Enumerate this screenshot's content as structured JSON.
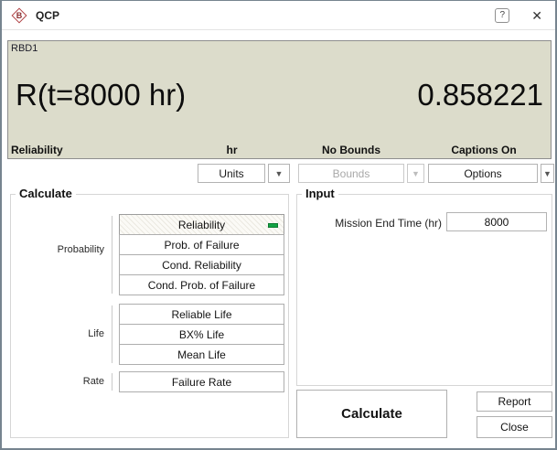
{
  "window": {
    "title": "QCP",
    "app_icon_letter": "B",
    "help_label": "?",
    "close_glyph": "✕"
  },
  "results": {
    "block_name": "RBD1",
    "expression": "R(t=8000 hr)",
    "value": "0.858221",
    "metric_caption": "Reliability",
    "units_caption": "hr",
    "bounds_caption": "No Bounds",
    "options_caption": "Captions On"
  },
  "dropdowns": {
    "units_label": "Units",
    "bounds_label": "Bounds",
    "options_label": "Options",
    "arrow_glyph": "▼"
  },
  "calculate_group": {
    "title": "Calculate",
    "sections": [
      {
        "label": "Probability",
        "buttons": [
          "Reliability",
          "Prob. of Failure",
          "Cond. Reliability",
          "Cond. Prob. of Failure"
        ],
        "selected": "Reliability"
      },
      {
        "label": "Life",
        "buttons": [
          "Reliable Life",
          "BX% Life",
          "Mean Life"
        ]
      },
      {
        "label": "Rate",
        "buttons": [
          "Failure Rate"
        ]
      }
    ]
  },
  "input_group": {
    "title": "Input",
    "field_label": "Mission End Time (hr)",
    "field_value": "8000"
  },
  "actions": {
    "calculate_label": "Calculate",
    "report_label": "Report",
    "close_label": "Close"
  },
  "colors": {
    "panel_bg": "#dcdccb",
    "selected_green": "#12a345",
    "brand_red": "#b04043",
    "window_border": "#76848f"
  }
}
